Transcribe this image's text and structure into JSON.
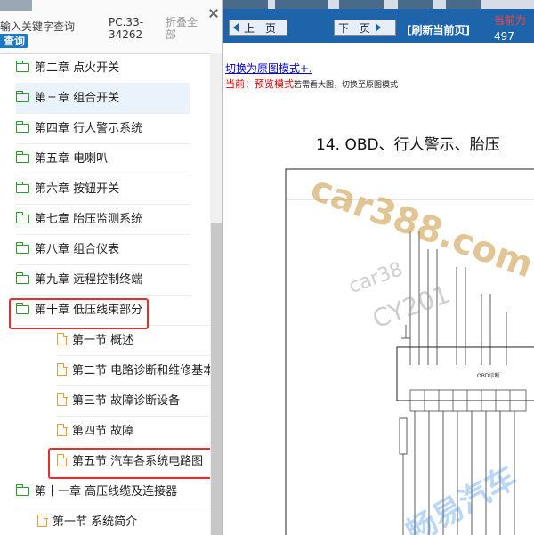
{
  "sidebar": {
    "search_hint": "输入关键字查询",
    "query_button": "查询",
    "doc_code": "PC.33-34262",
    "fold_all": "折叠全部",
    "items": [
      {
        "label": "第二章 点火开关",
        "type": "folder"
      },
      {
        "label": "第三章 组合开关",
        "type": "folder"
      },
      {
        "label": "第四章 行人警示系统",
        "type": "folder"
      },
      {
        "label": "第五章 电喇叭",
        "type": "folder"
      },
      {
        "label": "第六章 按钮开关",
        "type": "folder"
      },
      {
        "label": "第七章 胎压监测系统",
        "type": "folder"
      },
      {
        "label": "第八章 组合仪表",
        "type": "folder"
      },
      {
        "label": "第九章 远程控制终端",
        "type": "folder"
      },
      {
        "label": "第十章 低压线束部分",
        "type": "folder"
      },
      {
        "label": "第一节 概述",
        "type": "file"
      },
      {
        "label": "第二节 电路诊断和维修基本",
        "type": "file"
      },
      {
        "label": "第三节 故障诊断设备",
        "type": "file"
      },
      {
        "label": "第四节 故障",
        "type": "file"
      },
      {
        "label": "第五节 汽车各系统电路图",
        "type": "file"
      },
      {
        "label": "第十一章 高压线缆及连接器",
        "type": "folder"
      },
      {
        "label": "第一节 系统简介",
        "type": "file"
      }
    ]
  },
  "viewer": {
    "prev_page": "上一页",
    "next_page": "下一页",
    "refresh": "[刷新当前页]",
    "current_label": "当前为",
    "current_page": "497",
    "switch_original": "切换为原图模式+.",
    "mode_prefix": "当前：预览模式",
    "mode_suffix": "若需看大图，切换至原图模式",
    "doc_title": "14.   OBD、行人警示、胎压",
    "obd_label": "OBD诊断"
  },
  "watermarks": {
    "wm1": "car388.com",
    "wm2": "car38",
    "wm3": "CY201",
    "wm4": "畅易汽车"
  },
  "colors": {
    "toolbar": "#1e64aa",
    "highlight_box": "#e03030",
    "folder_icon": "#2e9a2e",
    "file_icon": "#e0a040"
  }
}
